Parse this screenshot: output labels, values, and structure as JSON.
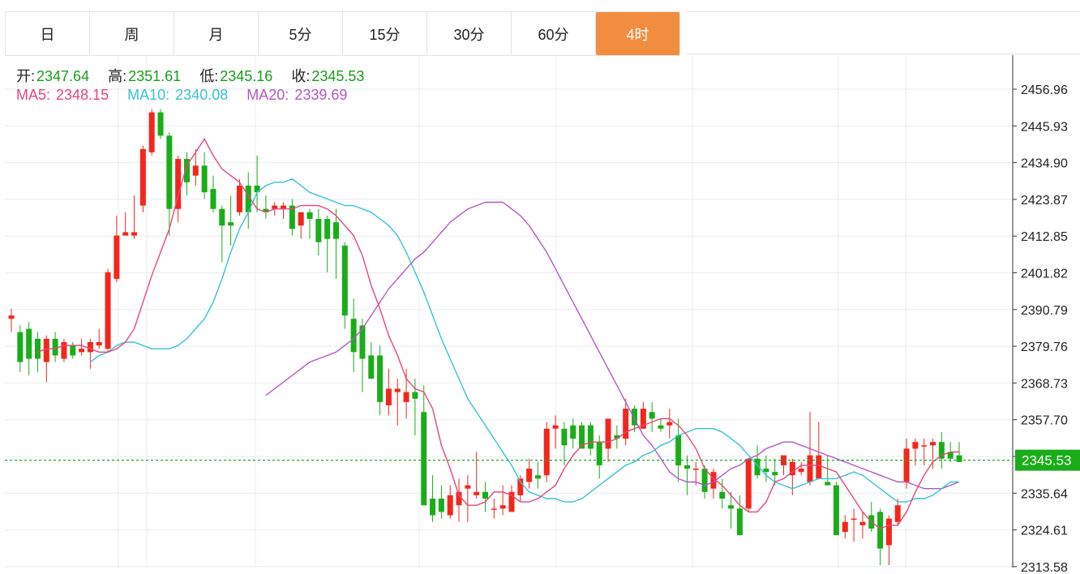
{
  "tabs": [
    {
      "label": "日"
    },
    {
      "label": "周"
    },
    {
      "label": "月"
    },
    {
      "label": "5分"
    },
    {
      "label": "15分"
    },
    {
      "label": "30分"
    },
    {
      "label": "60分"
    },
    {
      "label": "4时"
    }
  ],
  "active_tab": 7,
  "ohlc": {
    "open_label": "开:",
    "open": "2347.64",
    "high_label": "高:",
    "high": "2351.61",
    "low_label": "低:",
    "low": "2345.16",
    "close_label": "收:",
    "close": "2345.53"
  },
  "ma": {
    "ma5_label": "MA5:",
    "ma5": "2348.15",
    "ma10_label": "MA10:",
    "ma10": "2340.08",
    "ma20_label": "MA20:",
    "ma20": "2339.69"
  },
  "colors": {
    "up": "#f2271c",
    "down": "#1aad19",
    "accent": "#f28d3f",
    "ma5": "#e8467c",
    "ma10": "#36c3d4",
    "ma20": "#b358c4",
    "grid": "#e9edf3",
    "text_green": "#1a9d1a",
    "price_tag": "#1aad19"
  },
  "chart_data": {
    "type": "candlestick",
    "y_ticks": [
      "2456.96",
      "2445.93",
      "2434.90",
      "2423.87",
      "2412.85",
      "2401.82",
      "2390.79",
      "2379.76",
      "2368.73",
      "2357.70",
      "2346.67",
      "2335.64",
      "2324.61",
      "2313.58"
    ],
    "ylim": [
      2311,
      2463
    ],
    "last_price": "2345.53",
    "candles": [
      [
        2388,
        2391,
        2384,
        2389
      ],
      [
        2384,
        2386,
        2372,
        2375
      ],
      [
        2385,
        2387,
        2371,
        2376
      ],
      [
        2382,
        2384,
        2372,
        2376
      ],
      [
        2375,
        2383,
        2369,
        2382
      ],
      [
        2382,
        2384,
        2375,
        2377
      ],
      [
        2376,
        2382,
        2375,
        2381
      ],
      [
        2380,
        2381,
        2376,
        2377
      ],
      [
        2378,
        2382,
        2377,
        2379
      ],
      [
        2378,
        2382,
        2373,
        2381
      ],
      [
        2380,
        2385,
        2379,
        2381
      ],
      [
        2379,
        2403,
        2378,
        2402
      ],
      [
        2400,
        2419,
        2399,
        2413
      ],
      [
        2413,
        2420,
        2413,
        2414
      ],
      [
        2413,
        2425,
        2412,
        2414
      ],
      [
        2422,
        2440,
        2420,
        2439
      ],
      [
        2438,
        2451,
        2437,
        2450
      ],
      [
        2450,
        2451,
        2442,
        2443
      ],
      [
        2443,
        2444,
        2413,
        2421
      ],
      [
        2421,
        2437,
        2417,
        2436
      ],
      [
        2436,
        2438,
        2425,
        2429
      ],
      [
        2431,
        2439,
        2428,
        2434
      ],
      [
        2434,
        2438,
        2424,
        2426
      ],
      [
        2427,
        2431,
        2420,
        2421
      ],
      [
        2421,
        2422,
        2405,
        2416
      ],
      [
        2417,
        2425,
        2410,
        2416
      ],
      [
        2420,
        2430,
        2419,
        2428
      ],
      [
        2428,
        2432,
        2415,
        2420
      ],
      [
        2428,
        2437,
        2420,
        2426
      ],
      [
        2421,
        2425,
        2418,
        2420
      ],
      [
        2421,
        2423,
        2419,
        2422
      ],
      [
        2421,
        2423,
        2418,
        2422
      ],
      [
        2422,
        2424,
        2413,
        2415
      ],
      [
        2416,
        2420,
        2412,
        2420
      ],
      [
        2420,
        2421,
        2412,
        2418
      ],
      [
        2418,
        2421,
        2407,
        2411
      ],
      [
        2418,
        2419,
        2402,
        2412
      ],
      [
        2417,
        2421,
        2400,
        2412
      ],
      [
        2410,
        2411,
        2385,
        2389
      ],
      [
        2388,
        2394,
        2372,
        2378
      ],
      [
        2386,
        2388,
        2366,
        2376
      ],
      [
        2377,
        2381,
        2371,
        2370
      ],
      [
        2377,
        2380,
        2359,
        2363
      ],
      [
        2362,
        2373,
        2359,
        2367
      ],
      [
        2366,
        2370,
        2356,
        2367
      ],
      [
        2363,
        2373,
        2358,
        2366
      ],
      [
        2366,
        2370,
        2353,
        2364
      ],
      [
        2360,
        2368,
        2354,
        2332
      ],
      [
        2334,
        2341,
        2327,
        2329
      ],
      [
        2334,
        2338,
        2328,
        2330
      ],
      [
        2329,
        2338,
        2328,
        2335
      ],
      [
        2332,
        2340,
        2327,
        2336
      ],
      [
        2337,
        2341,
        2327,
        2338
      ],
      [
        2335,
        2348,
        2334,
        2336
      ],
      [
        2336,
        2339,
        2330,
        2334
      ],
      [
        2331,
        2334,
        2328,
        2331
      ],
      [
        2331,
        2338,
        2329,
        2332
      ],
      [
        2330,
        2338,
        2330,
        2336
      ],
      [
        2335,
        2341,
        2333,
        2340
      ],
      [
        2339,
        2346,
        2337,
        2343
      ],
      [
        2341,
        2345,
        2337,
        2340
      ],
      [
        2341,
        2357,
        2339,
        2355
      ],
      [
        2355,
        2359,
        2349,
        2356
      ],
      [
        2355,
        2357,
        2344,
        2350
      ],
      [
        2356,
        2358,
        2349,
        2352
      ],
      [
        2356,
        2357,
        2349,
        2349
      ],
      [
        2356,
        2357,
        2347,
        2349
      ],
      [
        2351,
        2353,
        2340,
        2344
      ],
      [
        2349,
        2358,
        2345,
        2358
      ],
      [
        2353,
        2356,
        2349,
        2352
      ],
      [
        2352,
        2364,
        2350,
        2361
      ],
      [
        2361,
        2362,
        2354,
        2356
      ],
      [
        2355,
        2363,
        2355,
        2361
      ],
      [
        2360,
        2363,
        2354,
        2358
      ],
      [
        2356,
        2358,
        2354,
        2355
      ],
      [
        2356,
        2361,
        2352,
        2357
      ],
      [
        2353,
        2358,
        2339,
        2344
      ],
      [
        2344,
        2347,
        2335,
        2343
      ],
      [
        2343,
        2345,
        2338,
        2343
      ],
      [
        2343,
        2344,
        2334,
        2336
      ],
      [
        2337,
        2343,
        2334,
        2342
      ],
      [
        2336,
        2340,
        2331,
        2334
      ],
      [
        2332,
        2336,
        2325,
        2331
      ],
      [
        2331,
        2335,
        2323,
        2323
      ],
      [
        2331,
        2345,
        2330,
        2346
      ],
      [
        2346,
        2350,
        2340,
        2341
      ],
      [
        2343,
        2347,
        2339,
        2342
      ],
      [
        2342,
        2346,
        2338,
        2341
      ],
      [
        2344,
        2347,
        2341,
        2347
      ],
      [
        2341,
        2346,
        2335,
        2345
      ],
      [
        2342,
        2345,
        2341,
        2343
      ],
      [
        2339,
        2360,
        2338,
        2347
      ],
      [
        2340,
        2357,
        2340,
        2347
      ],
      [
        2339,
        2347,
        2338,
        2338
      ],
      [
        2338,
        2339,
        2323,
        2323
      ],
      [
        2324,
        2329,
        2322,
        2327
      ],
      [
        2328,
        2331,
        2321,
        2328
      ],
      [
        2326,
        2330,
        2322,
        2327
      ],
      [
        2329,
        2333,
        2324,
        2325
      ],
      [
        2330,
        2331,
        2314,
        2319
      ],
      [
        2320,
        2329,
        2314,
        2328
      ],
      [
        2327,
        2334,
        2326,
        2332
      ],
      [
        2339,
        2352,
        2337,
        2349
      ],
      [
        2349,
        2352,
        2344,
        2351
      ],
      [
        2350,
        2352,
        2344,
        2350
      ],
      [
        2350,
        2352,
        2343,
        2351
      ],
      [
        2351,
        2354,
        2343,
        2346
      ],
      [
        2348,
        2351,
        2345,
        2346
      ],
      [
        2347,
        2351,
        2345,
        2345
      ]
    ],
    "ma5": [
      2378,
      2379,
      2379,
      2380,
      2380,
      2380,
      2379,
      2378,
      2378,
      2379,
      2381,
      2385,
      2393,
      2401,
      2408,
      2415,
      2425,
      2434,
      2438,
      2442,
      2437,
      2433,
      2431,
      2429,
      2425,
      2421,
      2420,
      2421,
      2421,
      2421,
      2422,
      2422,
      2422,
      2421,
      2419,
      2416,
      2413,
      2407,
      2398,
      2391,
      2383,
      2377,
      2370,
      2367,
      2366,
      2361,
      2350,
      2343,
      2335,
      2332,
      2332,
      2333,
      2336,
      2336,
      2335,
      2333,
      2333,
      2334,
      2336,
      2338,
      2343,
      2347,
      2350,
      2351,
      2351,
      2351,
      2352,
      2354,
      2355,
      2356,
      2357,
      2358,
      2358,
      2356,
      2353,
      2349,
      2343,
      2340,
      2338,
      2335,
      2332,
      2330,
      2330,
      2333,
      2339,
      2340,
      2342,
      2344,
      2344,
      2344,
      2343,
      2342,
      2338,
      2334,
      2330,
      2327,
      2325,
      2326,
      2326,
      2330,
      2336,
      2341,
      2345,
      2347,
      2348,
      2348
    ],
    "ma10": [
      2375,
      2377,
      2378,
      2380,
      2381,
      2381,
      2380,
      2379,
      2379,
      2379,
      2380,
      2382,
      2385,
      2388,
      2393,
      2400,
      2408,
      2415,
      2420,
      2426,
      2428,
      2429,
      2429,
      2430,
      2428,
      2426,
      2425,
      2424,
      2423,
      2422,
      2422,
      2421,
      2420,
      2418,
      2416,
      2413,
      2408,
      2402,
      2396,
      2389,
      2382,
      2376,
      2370,
      2364,
      2360,
      2356,
      2352,
      2348,
      2344,
      2339,
      2336,
      2335,
      2334,
      2334,
      2333,
      2333,
      2334,
      2336,
      2338,
      2340,
      2342,
      2344,
      2345,
      2347,
      2348,
      2350,
      2351,
      2353,
      2354,
      2355,
      2355,
      2355,
      2354,
      2352,
      2350,
      2347,
      2344,
      2341,
      2339,
      2338,
      2337,
      2338,
      2339,
      2340,
      2340,
      2340,
      2341,
      2342,
      2341,
      2339,
      2337,
      2335,
      2333,
      2333,
      2334,
      2334,
      2335,
      2337,
      2339,
      2339
    ],
    "ma20": [
      2365,
      2367,
      2369,
      2371,
      2373,
      2375,
      2376,
      2377,
      2378,
      2380,
      2382,
      2385,
      2389,
      2393,
      2397,
      2400,
      2403,
      2406,
      2408,
      2411,
      2414,
      2417,
      2419,
      2421,
      2422,
      2423,
      2423,
      2423,
      2421,
      2419,
      2416,
      2412,
      2408,
      2403,
      2398,
      2393,
      2388,
      2383,
      2378,
      2373,
      2368,
      2363,
      2358,
      2353,
      2350,
      2346,
      2342,
      2340,
      2339,
      2339,
      2338,
      2339,
      2341,
      2343,
      2344,
      2346,
      2347,
      2349,
      2350,
      2351,
      2351,
      2350,
      2349,
      2348,
      2347,
      2346,
      2345,
      2344,
      2343,
      2342,
      2341,
      2340,
      2339,
      2339,
      2338,
      2337,
      2337,
      2337,
      2338,
      2339
    ]
  }
}
